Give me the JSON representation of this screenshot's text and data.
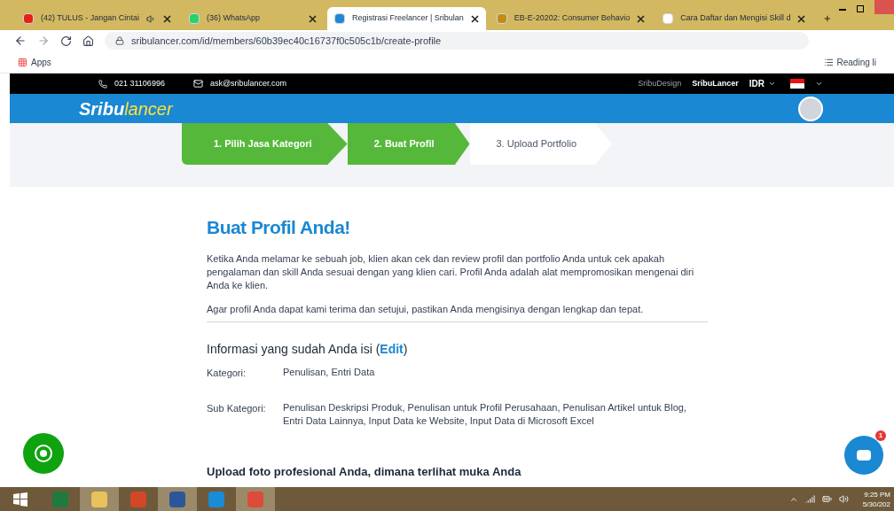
{
  "browser": {
    "tabs": [
      {
        "title": "(42) TULUS - Jangan Cintai",
        "kind": "youtube",
        "selected": false,
        "audio": true
      },
      {
        "title": "(36) WhatsApp",
        "kind": "whatsapp",
        "selected": false,
        "audio": false
      },
      {
        "title": "Registrasi Freelancer | Sribulan",
        "kind": "sribu",
        "selected": true,
        "audio": false
      },
      {
        "title": "EB-E-20202: Consumer Behavio",
        "kind": "moodle",
        "selected": false,
        "audio": false
      },
      {
        "title": "Cara Daftar dan Mengisi Skill d",
        "kind": "page",
        "selected": false,
        "audio": false
      }
    ],
    "url": "sribulancer.com/id/members/60b39ec40c16737f0c505c1b/create-profile",
    "bookmarks": [
      "Apps"
    ],
    "reading_list": "Reading li"
  },
  "topbar": {
    "phone": "021 31106996",
    "email": "ask@sribulancer.com",
    "links": [
      "SribuDesign",
      "SribuLancer"
    ],
    "currency": "IDR"
  },
  "header": {
    "logo_left": "Sribu",
    "logo_right": "lancer"
  },
  "steps": [
    {
      "label": "1. Pilih Jasa Kategori",
      "done": true
    },
    {
      "label": "2. Buat Profil",
      "done": true
    },
    {
      "label": "3. Upload Portfolio",
      "done": false
    }
  ],
  "content": {
    "title": "Buat Profil Anda!",
    "paragraphs": [
      "Ketika Anda melamar ke sebuah job, klien akan cek dan review profil dan portfolio Anda untuk cek apakah pengalaman dan skill Anda sesuai dengan yang klien cari. Profil Anda adalah alat mempromosikan mengenai diri Anda ke klien.",
      "Agar profil Anda dapat kami terima dan setujui, pastikan Anda mengisinya dengan lengkap dan tepat."
    ],
    "info_heading": "Informasi yang sudah Anda isi (",
    "info_link": "Edit",
    "info_close": ")",
    "fields": [
      {
        "label": "Kategori:",
        "value": "Penulisan, Entri Data"
      },
      {
        "label": "Sub Kategori:",
        "value": "Penulisan Deskripsi Produk, Penulisan untuk Profil Perusahaan, Penulisan Artikel untuk Blog, Entri Data Lainnya, Input Data ke Website, Input Data di Microsoft Excel"
      }
    ],
    "next_heading": "Upload foto profesional Anda, dimana terlihat muka Anda"
  },
  "chat_badge": "1",
  "taskbar": {
    "apps": [
      {
        "kind": "excel",
        "selected": false
      },
      {
        "kind": "files",
        "selected": true
      },
      {
        "kind": "powerpoint",
        "selected": false
      },
      {
        "kind": "word",
        "selected": true
      },
      {
        "kind": "edge",
        "selected": false
      },
      {
        "kind": "chrome",
        "selected": true
      }
    ],
    "time": "9:25 PM",
    "date": "5/30/202"
  }
}
